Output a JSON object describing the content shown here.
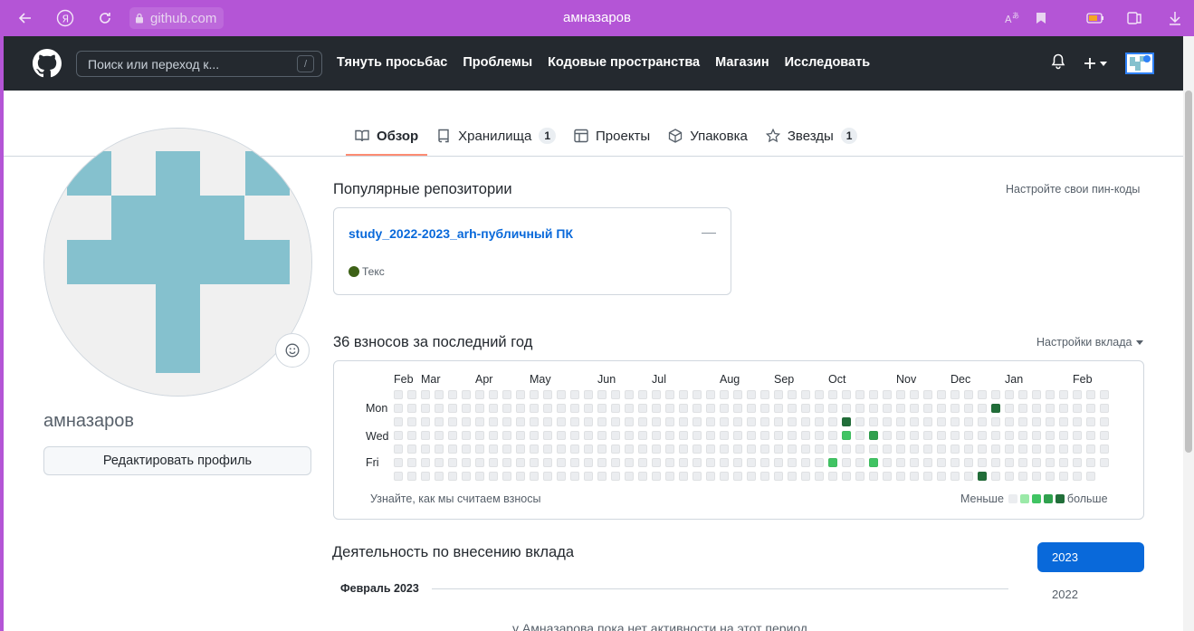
{
  "browser": {
    "url": "github.com",
    "title": "амназаров"
  },
  "header": {
    "search_placeholder": "Поиск или переход к...",
    "search_shortcut": "/",
    "nav": [
      "Тянуть просьбас",
      "Проблемы",
      "Кодовые пространства",
      "Магазин",
      "Исследовать"
    ]
  },
  "tabs": [
    {
      "label": "Обзор",
      "icon": "book-icon",
      "active": true
    },
    {
      "label": "Хранилища",
      "icon": "repo-icon",
      "count": "1"
    },
    {
      "label": "Проекты",
      "icon": "table-icon"
    },
    {
      "label": "Упаковка",
      "icon": "package-icon"
    },
    {
      "label": "Звезды",
      "icon": "star-icon",
      "count": "1"
    }
  ],
  "profile": {
    "username": "амназаров",
    "edit_button": "Редактировать профиль",
    "avatar_color": "#85c1ce"
  },
  "pinned": {
    "title": "Популярные репозитории",
    "customize": "Настройте свои пин-коды",
    "repo_name": "study_2022-2023_arh-публичный ПК",
    "language": "Текс",
    "language_color": "#3d6117"
  },
  "contributions": {
    "title": "36 взносов за последний год",
    "settings": "Настройки вклада",
    "months": [
      "Feb",
      "Mar",
      "Apr",
      "May",
      "Jun",
      "Jul",
      "Aug",
      "Sep",
      "Oct",
      "Nov",
      "Dec",
      "Jan",
      "Feb"
    ],
    "days": [
      "Mon",
      "Wed",
      "Fri"
    ],
    "learn": "Узнайте, как мы считаем взносы",
    "less": "Меньше",
    "more": "больше",
    "levels": [
      "#ebedf0",
      "#9be9a8",
      "#40c463",
      "#30a14e",
      "#216e39"
    ],
    "active_cells": [
      {
        "week": 32,
        "day": 5,
        "level": 2
      },
      {
        "week": 33,
        "day": 2,
        "level": 4
      },
      {
        "week": 33,
        "day": 3,
        "level": 2
      },
      {
        "week": 35,
        "day": 3,
        "level": 3
      },
      {
        "week": 35,
        "day": 5,
        "level": 2
      },
      {
        "week": 43,
        "day": 6,
        "level": 4
      },
      {
        "week": 44,
        "day": 1,
        "level": 4
      }
    ]
  },
  "activity": {
    "title": "Деятельность по внесению вклада",
    "month": "Февраль 2023",
    "years": [
      "2023",
      "2022"
    ],
    "empty": "у Амназарова пока нет активности на этот период."
  }
}
